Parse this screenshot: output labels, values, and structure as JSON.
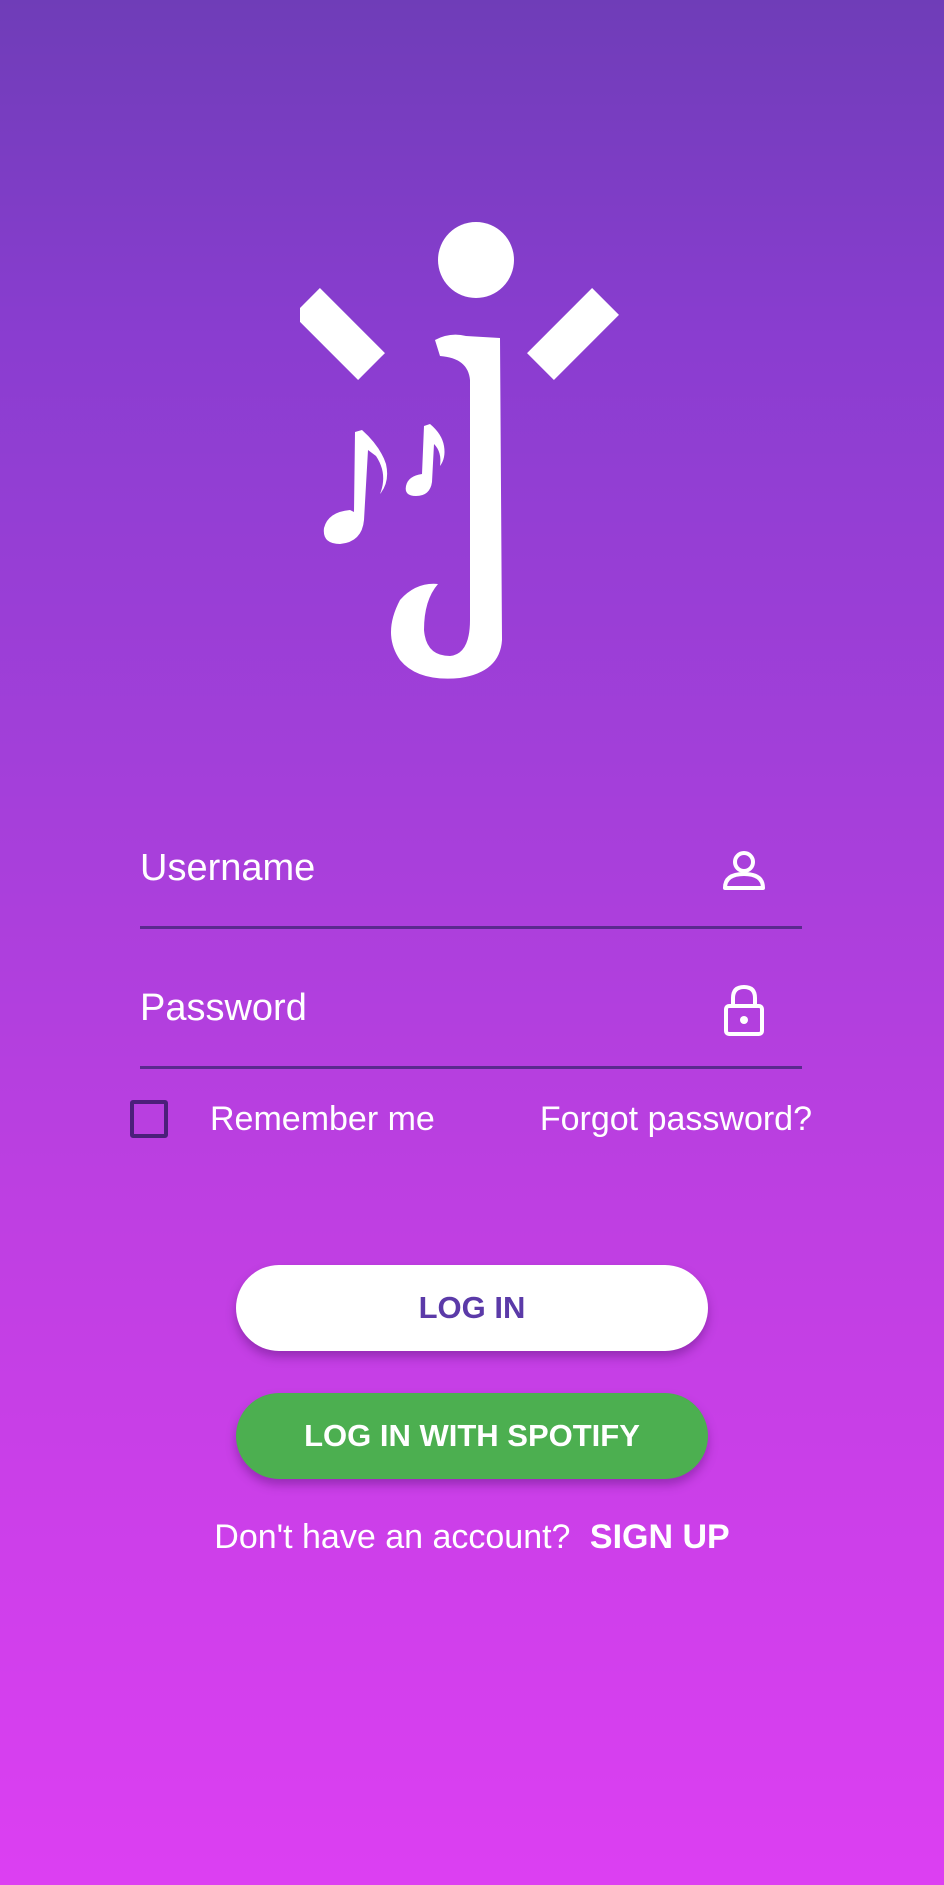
{
  "app": {
    "logo_icon": "jubilant-j-music-notes-logo"
  },
  "form": {
    "username_placeholder": "Username",
    "username_icon": "person-icon",
    "password_placeholder": "Password",
    "password_icon": "lock-icon",
    "remember_label": "Remember me",
    "remember_checked": false,
    "forgot_label": "Forgot password?"
  },
  "actions": {
    "login_label": "LOG IN",
    "spotify_label": "LOG IN WITH SPOTIFY",
    "signup_prompt": "Don't have an account?",
    "signup_label": "SIGN UP"
  },
  "colors": {
    "gradient_top": "#6f3db8",
    "gradient_bottom": "#dc3ff2",
    "login_text": "#5b3aa8",
    "spotify_green": "#4caf50",
    "field_underline": "#5a2a8e"
  }
}
